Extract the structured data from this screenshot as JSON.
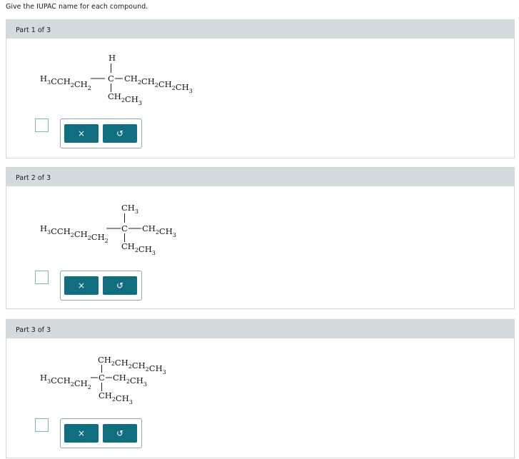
{
  "prompt": "Give the IUPAC name for each compound.",
  "icons": {
    "clear": "×",
    "undo": "↺"
  },
  "parts": [
    {
      "label": "Part 1 of 3",
      "top_group": [
        [
          "H",
          ""
        ]
      ],
      "left_chain": [
        [
          "H",
          "3"
        ],
        [
          "CCH",
          "2"
        ],
        [
          "CH",
          "2"
        ]
      ],
      "center": "C",
      "right_chain": [
        [
          "CH",
          "2"
        ],
        [
          "CH",
          "2"
        ],
        [
          "CH",
          "2"
        ],
        [
          "CH",
          "3"
        ]
      ],
      "bottom_group": [
        [
          "CH",
          "2"
        ],
        [
          "CH",
          "3"
        ]
      ]
    },
    {
      "label": "Part 2 of 3",
      "top_group": [
        [
          "CH",
          "3"
        ]
      ],
      "left_chain": [
        [
          "H",
          "3"
        ],
        [
          "CCH",
          "2"
        ],
        [
          "CH",
          "2"
        ],
        [
          "CH",
          "2"
        ]
      ],
      "center": "C",
      "right_chain": [
        [
          "CH",
          "2"
        ],
        [
          "CH",
          "3"
        ]
      ],
      "bottom_group": [
        [
          "CH",
          "2"
        ],
        [
          "CH",
          "3"
        ]
      ]
    },
    {
      "label": "Part 3 of 3",
      "top_group": [
        [
          "CH",
          "2"
        ],
        [
          "CH",
          "2"
        ],
        [
          "CH",
          "2"
        ],
        [
          "CH",
          "3"
        ]
      ],
      "left_chain": [
        [
          "H",
          "3"
        ],
        [
          "CCH",
          "2"
        ],
        [
          "CH",
          "2"
        ]
      ],
      "center": "C",
      "right_chain": [
        [
          "CH",
          "2"
        ],
        [
          "CH",
          "3"
        ]
      ],
      "bottom_group": [
        [
          "CH",
          "2"
        ],
        [
          "CH",
          "3"
        ]
      ]
    }
  ]
}
